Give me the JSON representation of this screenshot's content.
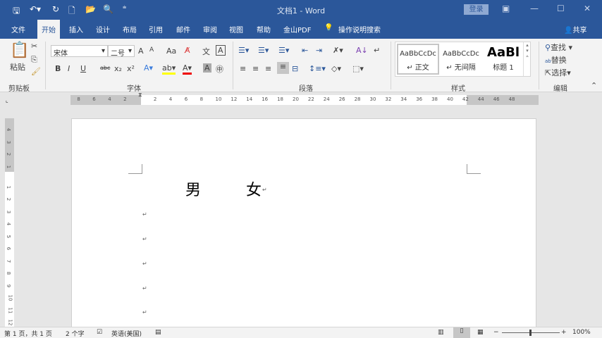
{
  "window": {
    "title": "文档1 - Word",
    "login": "登录"
  },
  "quick_access": {
    "icons": [
      "save-icon",
      "undo-icon",
      "redo-icon",
      "new-icon",
      "open-icon",
      "print-preview-icon",
      "customize-icon"
    ]
  },
  "tabs": [
    "文件",
    "开始",
    "插入",
    "设计",
    "布局",
    "引用",
    "邮件",
    "审阅",
    "视图",
    "帮助",
    "金山PDF"
  ],
  "active_tab": "开始",
  "search_label": "操作说明搜索",
  "share_label": "共享",
  "clipboard": {
    "paste": "粘贴",
    "group": "剪贴板"
  },
  "font": {
    "name": "宋体",
    "size": "二号",
    "group": "字体",
    "bold": "B",
    "italic": "I",
    "underline": "U",
    "strike": "abc",
    "sub": "x₂",
    "sup": "x²",
    "change_case": "Aa",
    "grow": "A",
    "shrink": "A"
  },
  "paragraph": {
    "group": "段落"
  },
  "styles": {
    "group": "样式",
    "items": [
      {
        "preview": "AaBbCcDc",
        "label": "↵ 正文"
      },
      {
        "preview": "AaBbCcDc",
        "label": "↵ 无间隔"
      },
      {
        "preview": "AaBl",
        "label": "标题 1"
      }
    ]
  },
  "editing": {
    "group": "编辑",
    "find": "查找",
    "replace": "替换",
    "select": "选择"
  },
  "ruler": {
    "left": [
      "8",
      "6",
      "4",
      "2"
    ],
    "right": [
      "2",
      "4",
      "6",
      "8",
      "10",
      "12",
      "14",
      "16",
      "18",
      "20",
      "22",
      "24",
      "26",
      "28",
      "30",
      "32",
      "34",
      "36",
      "38",
      "40",
      "42",
      "44",
      "46",
      "48"
    ],
    "vertical": [
      "4",
      "3",
      "2",
      "1",
      "1",
      "2",
      "3",
      "4",
      "5",
      "6",
      "7",
      "8",
      "9",
      "10",
      "11",
      "12"
    ]
  },
  "document": {
    "line1_a": "男",
    "line1_b": "女",
    "mark": "↵"
  },
  "status": {
    "page": "第 1 页，共 1 页",
    "words": "2 个字",
    "language": "英语(美国)",
    "zoom": "100%"
  }
}
